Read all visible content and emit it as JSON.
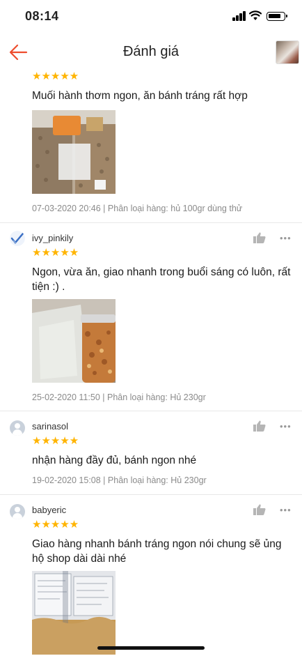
{
  "status_bar": {
    "time": "08:14"
  },
  "header": {
    "title": "Đánh giá"
  },
  "colors": {
    "accent": "#ee4d2d",
    "star": "#ffb400"
  },
  "reviews": [
    {
      "username": "",
      "stars": "★★★★★",
      "text": "Muối hành thơm ngon, ăn bánh tráng rất hợp",
      "date": "07-03-2020 20:46",
      "variant": "Phân loại hàng: hủ 100gr dùng thử"
    },
    {
      "username": "ivy_pinkily",
      "stars": "★★★★★",
      "text": "Ngon, vừa ăn, giao nhanh trong buổi sáng có luôn, rất tiện :) .",
      "date": "25-02-2020 11:50",
      "variant": "Phân loại hàng: Hủ 230gr"
    },
    {
      "username": "sarinasol",
      "stars": "★★★★★",
      "text": "nhận hàng đầy đủ, bánh ngon nhé",
      "date": "19-02-2020 15:08",
      "variant": "Phân loại hàng: Hủ 230gr"
    },
    {
      "username": "babyeric",
      "stars": "★★★★★",
      "text": "Giao hàng nhanh bánh tráng ngon nói chung sẽ ủng hộ shop dài dài nhé"
    }
  ],
  "icons": {
    "back": "arrow-left-icon",
    "like": "thumbs-up-icon",
    "more": "more-dots-icon"
  },
  "more_glyph": "•••",
  "meta_separator": " | "
}
